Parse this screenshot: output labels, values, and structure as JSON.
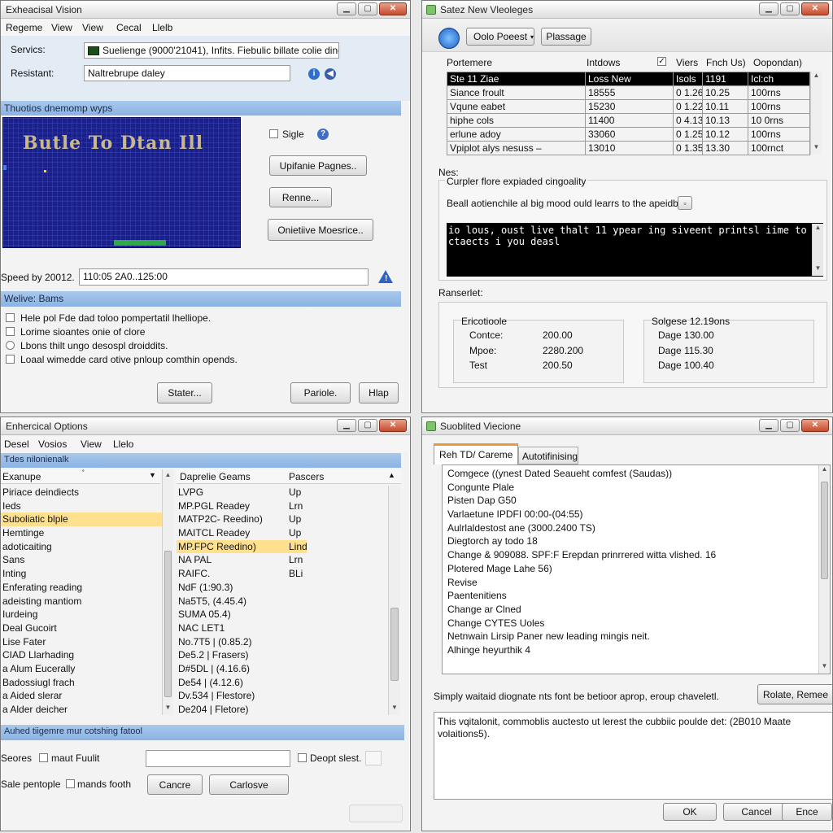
{
  "colors": {
    "accent_blue": "#8ab3e3",
    "selection_yellow": "#ffe08f",
    "terminal_bg": "#000000",
    "game_bg": "#1a1f8a"
  },
  "win_tl": {
    "title": "Exheacisal Vision",
    "menu": [
      "Regeme",
      "View",
      "View",
      "Cecal",
      "Llelb"
    ],
    "services_label": "Servics:",
    "services_value": "Suelienge (9000'21041), Infits. Fiebulic billate colie dine",
    "resistant_label": "Resistant:",
    "resistant_value": "Naltrebrupe daley",
    "section_header": "Thuotios dnemomp wyps",
    "game_title": "Butle To Dtan Ill",
    "sigle_label": "Sigle",
    "btn_update": "Upifanie Pagnes..",
    "btn_remove": "Renne...",
    "btn_options": "Onietiive Moesrice..",
    "speed_label": "Speed by 20012.",
    "speed_value": "110:05 2A0..125:00",
    "section2": "Welive: Bams",
    "checks": [
      "Hele pol Fde dad toloo pompertatil lhelliope.",
      "Lorime sioantes onie of clore",
      "Lbons thilt ungo desospl droiddits.",
      "Loaal wimedde card otive pnloup comthin opends."
    ],
    "btn_start": "Stater...",
    "btn_pariole": "Pariole.",
    "btn_help": "Hlap"
  },
  "win_tr": {
    "title": "Satez New Vleoleges",
    "tab_combo": "Oolo Poeest",
    "tab_plassage": "Plassage",
    "headers": [
      "Portemere",
      "Intdows",
      "Viers",
      "Fnch Us)",
      "Oopondan)"
    ],
    "rows": [
      [
        "Ste 11 Ziae",
        "Loss New",
        "Isols",
        "1191",
        "Icl:ch"
      ],
      [
        "Siance froult",
        "18555",
        "0 1.26",
        "10.25",
        "100rns"
      ],
      [
        "Vqune eabet",
        "15230",
        "0 1.22",
        "10.11",
        "100rns"
      ],
      [
        "hiphe cols",
        "11400",
        "0 4.13",
        "10.13",
        "10 0rns"
      ],
      [
        "erlune adoy",
        "33060",
        "0 1.25",
        "10.12",
        "100rns"
      ],
      [
        "Vpiplot alys nesuss –",
        "13010",
        "0 1.35",
        "13.30",
        "100rnct"
      ]
    ],
    "nes_label": "Nes:",
    "group_title": "Curpler flore expiaded cingoality",
    "bealt_text": "Beall aotienchile al big mood ould learrs to the apeidble",
    "terminal_text": "io lous, oust live thalt 11 ypear ing siveent printsl iime to ctaects i you deasl",
    "ranserlet_label": "Ranserlet:",
    "left_group_title": "Ericotioole",
    "left_rows": [
      [
        "Contce:",
        "200.00"
      ],
      [
        "Mpoe:",
        "2280.200"
      ],
      [
        "Test",
        "200.50"
      ]
    ],
    "right_group_title": "Solgese 12.19ons",
    "right_rows": [
      "Dage 130.00",
      "Dage 115.30",
      "Dage 100.40"
    ]
  },
  "win_bl": {
    "title": "Enhercical Options",
    "menu": [
      "Desel",
      "Vosios",
      "View",
      "Llelo"
    ],
    "header_bar": "Tdes nilonienalk",
    "left_header": "Exanupe",
    "left_items": [
      "Piriace deindiects",
      "Ieds",
      "Suboliatic blple",
      "Hemtinge",
      "adoticaiting",
      "Sans",
      "Inting",
      "Enferating reading",
      "adeisting mantiom",
      "Iurdeing",
      "Deal Gucoirt",
      "Lise Fater",
      "CIAD Llarhading",
      "a Alum Eucerally",
      "Badossiugl frach",
      "a Aided slerar",
      "a Alder deicher"
    ],
    "mid_header": "Daprelie Geams",
    "right_header": "Pascers",
    "mid_items": [
      "LVPG",
      "MP.PGL Readey",
      "MATP2C- Reedino)",
      "MAITCL Readey",
      "MP.FPC Reedino)",
      "NA PAL",
      "RAIFC.",
      "NdF (1:90.3)",
      "Na5T5, (4.45.4)",
      "SUMA 05.4)",
      "NAC LET1",
      "No.7T5 | (0.85.2)",
      "De5.2 | Frasers)",
      "D#5DL | (4.16.6)",
      "De54 | (4.12.6)",
      "Dv.534 | Flestore)",
      "De204 | Fletore)"
    ],
    "right_items": [
      "Up",
      "Lrn",
      "Up",
      "Up",
      "Lind",
      "Lrn",
      "BLi"
    ],
    "section2": "Auhed tiigemre mur cotshing fatool",
    "seores_label": "Seores",
    "maut_label": "maut Fuulit",
    "deopt_label": "Deopt slest.",
    "sale_label": "Sale pentople",
    "mands_label": "mands footh",
    "btn_cancel": "Cancre",
    "btn_carlosve": "Carlosve"
  },
  "win_br": {
    "title": "Suoblited Viecione",
    "tab1": "Reh TD/ Careme",
    "tab2": "Autotifinising",
    "items": [
      "Comgece ((ynest Dated Seaueht comfest (Saudas))",
      "Congunte Plale",
      "Pisten Dap G50",
      "Varlaetune IPDFI 00:00-(04:55)",
      "Aulrlaldestost ane (3000.2400 TS)",
      "Diegtorch ay todo 18",
      "Change & 909088. SPF:F Erepdan prinrrered witta vlished. 16",
      "Plotered Mage Lahe 56)",
      "Revise",
      "Paentenitiens",
      "Change ar Clned",
      "Change CYTES Uoles",
      "Netnwain Lirsip Paner new leading mingis neit.",
      "Alhinge heyurthik 4"
    ],
    "desc": "Simply waitaid diognate nts font be betioor aprop, eroup chaveletl.",
    "btn_rotate": "Rolate, Remee",
    "text_area": "This vqitalonit, commoblis auctesto ut lerest the cubbiic poulde det: (2B010 Maate volaitions5).",
    "btn_ok": "OK",
    "btn_cancel": "Cancel",
    "btn_ence": "Ence"
  }
}
